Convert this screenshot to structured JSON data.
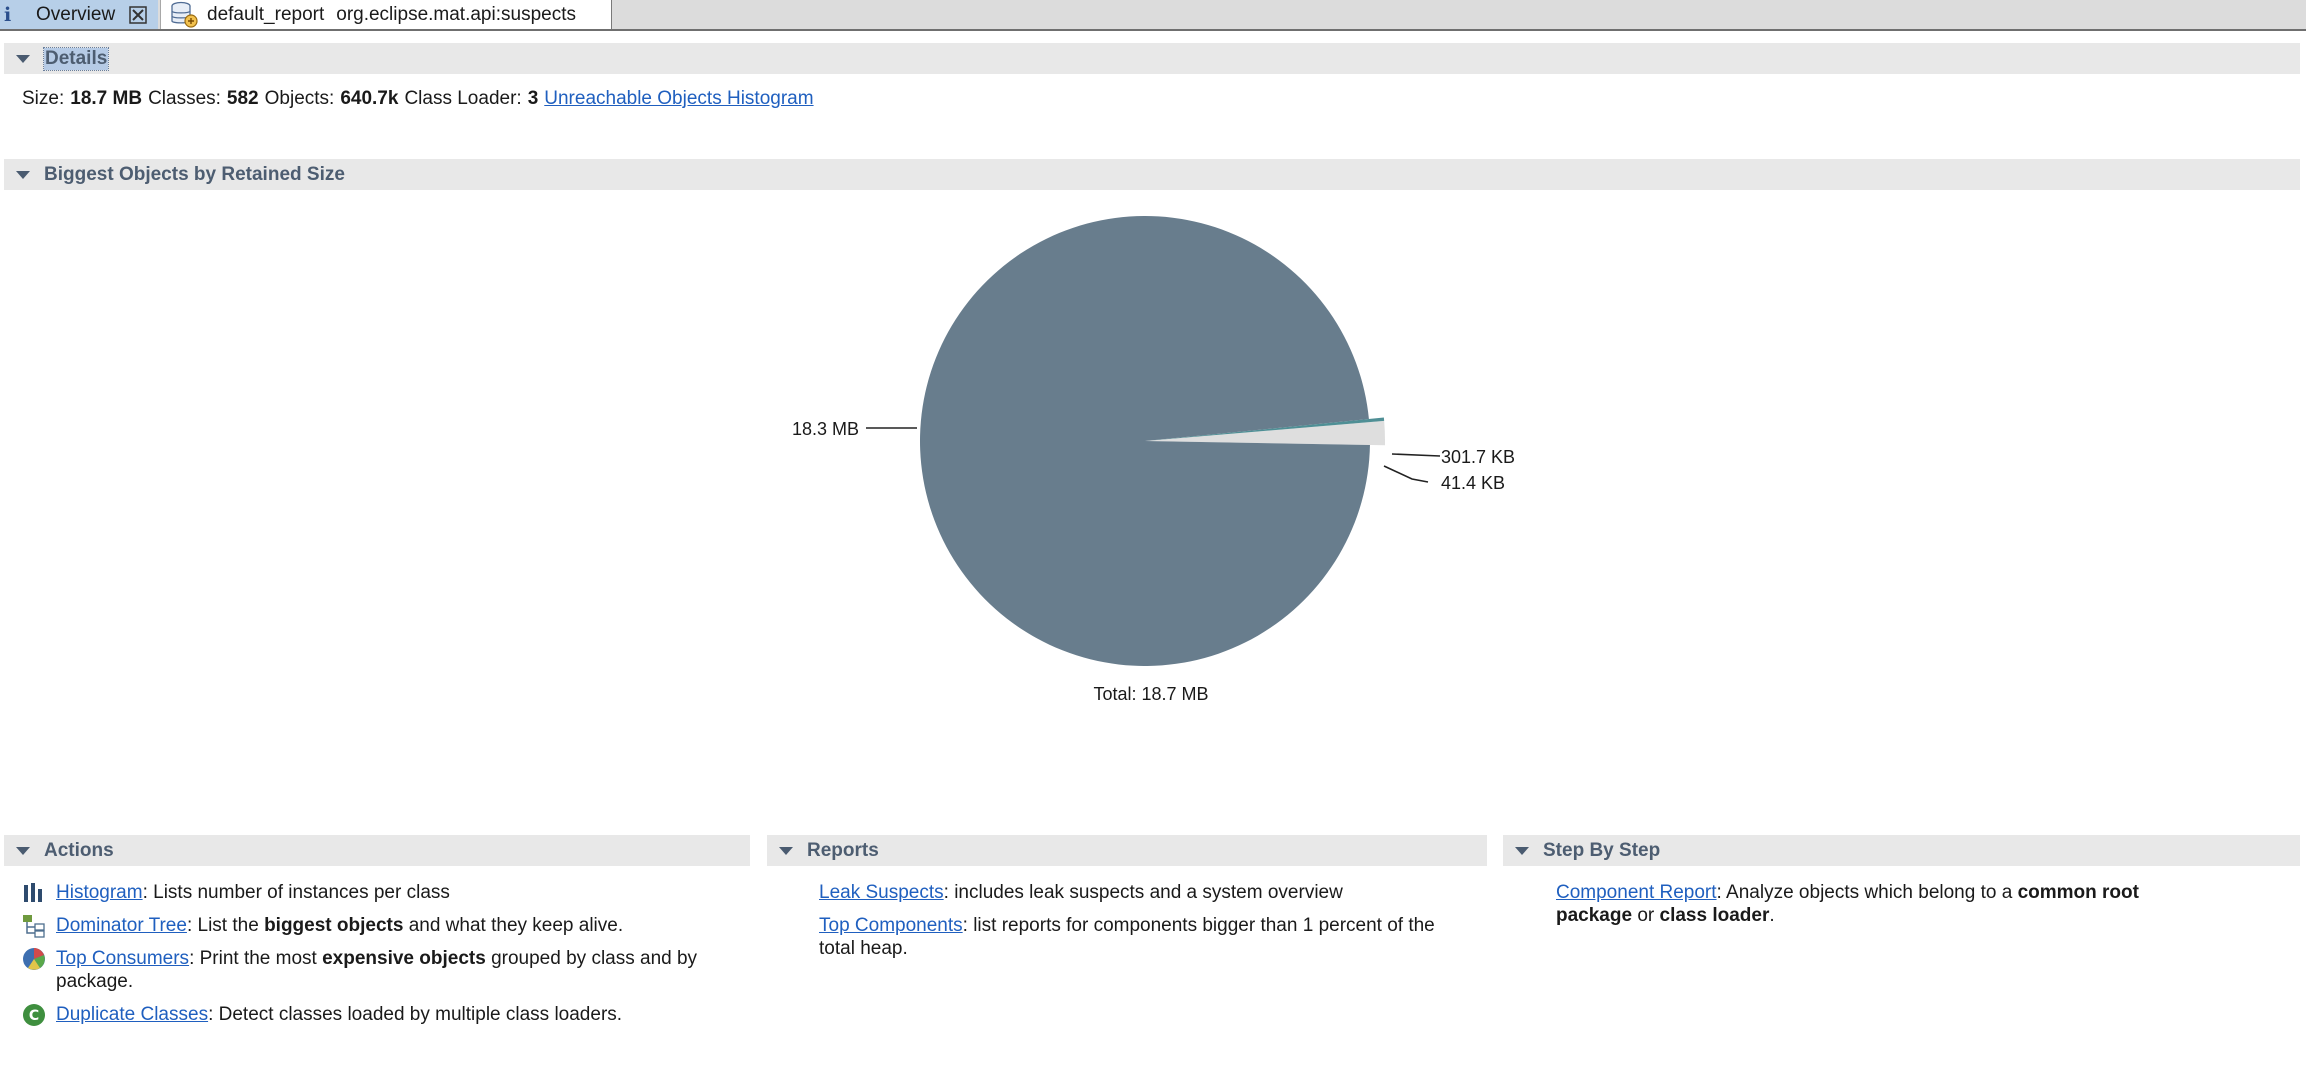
{
  "tabs": {
    "overview": "Overview",
    "report_name": "default_report",
    "report_query": "org.eclipse.mat.api:suspects"
  },
  "details": {
    "header": "Details",
    "size_label": "Size:",
    "size_value": "18.7 MB",
    "classes_label": "Classes:",
    "classes_value": "582",
    "objects_label": "Objects:",
    "objects_value": "640.7k",
    "classloader_label": "Class Loader:",
    "classloader_value": "3",
    "unreachable_link": "Unreachable Objects Histogram"
  },
  "biggest": {
    "header": "Biggest Objects by Retained Size",
    "total": "Total: 18.7 MB",
    "label_big": "18.3 MB",
    "label_mid": "301.7 KB",
    "label_small": "41.4 KB"
  },
  "chart_data": {
    "type": "pie",
    "title": "",
    "total": "Total: 18.7 MB",
    "slices": [
      {
        "label": "18.3 MB",
        "value": 18300,
        "color": "#687d8d"
      },
      {
        "label": "301.7 KB",
        "value": 301.7,
        "color": "#dedede"
      },
      {
        "label": "41.4 KB",
        "value": 41.4,
        "color": "#4f8f95"
      }
    ]
  },
  "actions": {
    "header": "Actions",
    "histogram_link": "Histogram",
    "histogram_desc": ": Lists number of instances per class",
    "dominator_link": "Dominator Tree",
    "dominator_desc_a": ": List the ",
    "dominator_bold": "biggest objects",
    "dominator_desc_b": " and what they keep alive.",
    "consumers_link": "Top Consumers",
    "consumers_desc_a": ": Print the most ",
    "consumers_bold": "expensive objects",
    "consumers_desc_b": " grouped by class and by package.",
    "duplicate_link": "Duplicate Classes",
    "duplicate_desc": ": Detect classes loaded by multiple class loaders."
  },
  "reports": {
    "header": "Reports",
    "leak_link": "Leak Suspects",
    "leak_desc": ": includes leak suspects and a system overview",
    "topcomp_link": "Top Components",
    "topcomp_desc": ": list reports for components bigger than 1 percent of the total heap."
  },
  "stepbystep": {
    "header": "Step By Step",
    "component_link": "Component Report",
    "component_desc_a": ": Analyze objects which belong to a ",
    "component_bold1": "common root package",
    "component_desc_b": " or ",
    "component_bold2": "class loader",
    "component_desc_c": "."
  }
}
